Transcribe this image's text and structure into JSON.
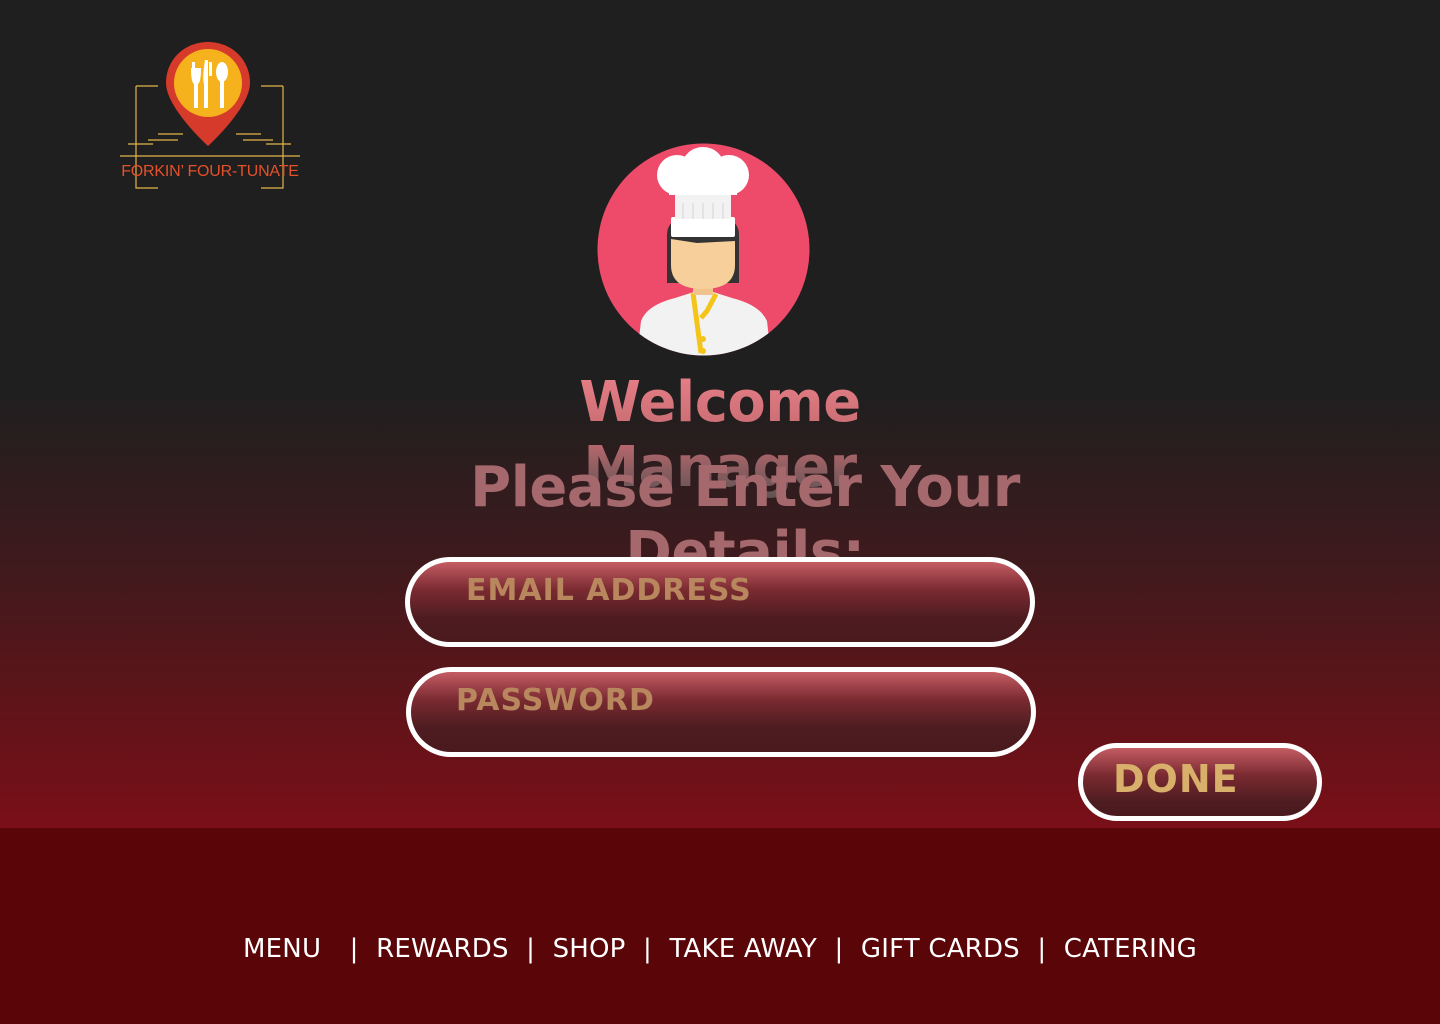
{
  "brand": {
    "name": "FORKIN’ FOUR-TUNATE",
    "logo_icon": "fork-knife-spoon-pin-icon",
    "colors": {
      "pin": "#d63a2b",
      "pin_inner": "#f5b21c",
      "text": "#e4512a"
    }
  },
  "avatar": {
    "icon": "chef-avatar-icon",
    "circle_color": "#ee4b6a"
  },
  "heading": {
    "welcome": "Welcome Manager",
    "instruction": "Please Enter Your Details:"
  },
  "form": {
    "email": {
      "placeholder": "EMAIL ADDRESS",
      "value": ""
    },
    "password": {
      "placeholder": "PASSWORD",
      "value": ""
    },
    "submit_label": "DONE"
  },
  "footer": {
    "nav": [
      "MENU",
      "REWARDS",
      "SHOP",
      "TAKE AWAY",
      "GIFT CARDS",
      "CATERING"
    ],
    "separator": "|"
  }
}
